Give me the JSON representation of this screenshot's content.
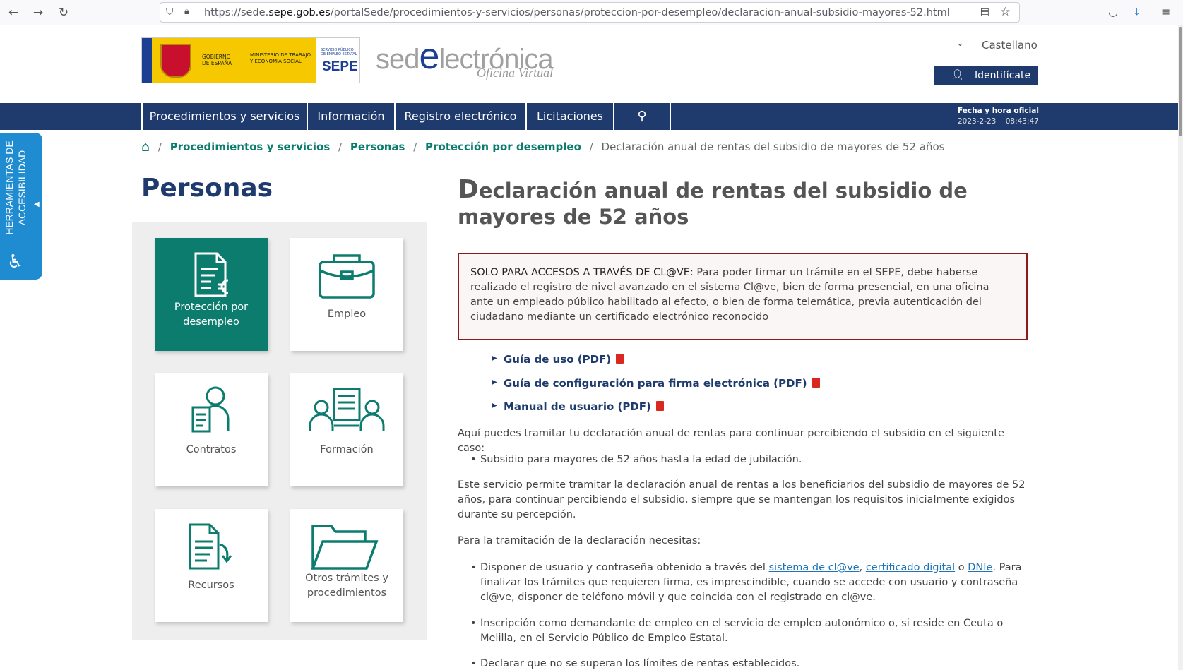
{
  "browser": {
    "url_prefix": "https://sede.",
    "url_domain": "sepe.gob.es",
    "url_path": "/portalSede/procedimientos-y-servicios/personas/proteccion-por-desempleo/declaracion-anual-subsidio-mayores-52.html"
  },
  "header": {
    "gov_label": "GOBIERNO DE ESPAÑA",
    "ministry_label": "MINISTERIO DE TRABAJO Y ECONOMÍA SOCIAL",
    "sepe_small": "SERVICIO PÚBLICO DE EMPLEO ESTATAL",
    "sepe_big": "SEPE",
    "sede_prefix": "sed",
    "sede_e": "e",
    "sede_suffix": "lectrónica",
    "sede_sub": "Oficina Virtual",
    "language": "Castellano",
    "identify_label": "Identifícate"
  },
  "navbar": {
    "items": [
      "Procedimientos y servicios",
      "Información",
      "Registro electrónico",
      "Licitaciones"
    ],
    "clock_title": "Fecha y hora oficial",
    "clock_date": "2023-2-23",
    "clock_time": "08:43:47"
  },
  "accessibility": {
    "label": "HERRAMIENTAS DE ACCESIBILIDAD"
  },
  "breadcrumb": {
    "items": [
      "Procedimientos y servicios",
      "Personas",
      "Protección por desempleo"
    ],
    "current": "Declaración anual de rentas del subsidio de mayores de 52 años"
  },
  "sidebar": {
    "title": "Personas",
    "cards": [
      {
        "label": "Protección por desempleo"
      },
      {
        "label": "Empleo"
      },
      {
        "label": "Contratos"
      },
      {
        "label": "Formación"
      },
      {
        "label": "Recursos"
      },
      {
        "label": "Otros trámites y procedimientos"
      }
    ]
  },
  "main": {
    "title_cap": "D",
    "title_rest": "eclaración anual de rentas del subsidio de mayores de 52 años",
    "alert_strong": "SOLO PARA ACCESOS A TRAVÉS DE CL@VE:",
    "alert_text": " Para poder firmar un trámite en el SEPE, debe haberse realizado el registro de nivel avanzado en el sistema Cl@ve, bien de forma presencial, en una oficina ante un empleado público habilitado al efecto, o bien de forma telemática, previa autenticación del ciudadano mediante un certificado electrónico reconocido",
    "links": [
      "Guía de uso (PDF)",
      "Guía de configuración para firma electrónica (PDF)",
      "Manual de usuario (PDF)"
    ],
    "intro": "Aquí puedes tramitar tu declaración anual de rentas para continuar percibiendo el subsidio en el siguiente caso:",
    "case_bullet": "Subsidio para mayores de 52 años hasta la edad de jubilación.",
    "service_text": "Este servicio permite tramitar la declaración anual de rentas a los beneficiarios del subsidio de mayores de 52 años, para continuar percibiendo el subsidio, siempre que se mantengan los requisitos inicialmente exigidos durante su percepción.",
    "needs_title": "Para la tramitación de la declaración necesitas:",
    "need1_a": "Disponer de usuario y contraseña obtenido a través del ",
    "need1_link1": "sistema de cl@ve",
    "need1_b": ", ",
    "need1_link2": "certificado digital",
    "need1_c": " o ",
    "need1_link3": "DNIe",
    "need1_d": ". Para finalizar los trámites que requieren firma, es imprescindible, cuando se accede con usuario y contraseña cl@ve, disponer de teléfono móvil y que coincida con el registrado en cl@ve.",
    "need2": "Inscripción como demandante de empleo en el servicio de empleo autonómico o, si reside en Ceuta o Melilla, en el Servicio Público de Empleo Estatal.",
    "need3": "Declarar que no se superan los límites de rentas establecidos."
  }
}
